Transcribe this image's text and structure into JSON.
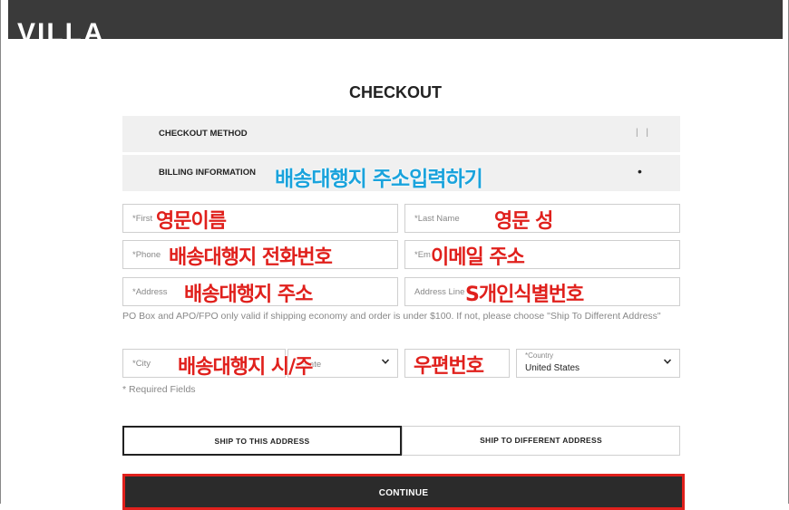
{
  "header": {
    "logo": "VILLA"
  },
  "page_title": "CHECKOUT",
  "steps": [
    {
      "label": "CHECKOUT METHOD",
      "marker": "| |"
    },
    {
      "label": "BILLING INFORMATION",
      "marker": "•",
      "overlay": "배송대행지 주소입력하기"
    }
  ],
  "form": {
    "first_name": {
      "placeholder": "*First",
      "overlay": "영문이름"
    },
    "last_name": {
      "placeholder": "*Last Name",
      "overlay": "영문 성"
    },
    "phone": {
      "placeholder": "*Phone",
      "overlay": "배송대행지 전화번호"
    },
    "email": {
      "placeholder": "*Em",
      "overlay": "이메일 주소"
    },
    "address": {
      "placeholder": "*Address",
      "overlay": "배송대행지 주소"
    },
    "address_line2": {
      "placeholder": "Address Line",
      "overlay": "S개인식별번호"
    },
    "po_note": "PO Box and APO/FPO only valid if shipping economy and order is under $100. If not, please choose \"Ship To Different Address\"",
    "city": {
      "placeholder": "*City",
      "overlay": "배송대행지 시/주"
    },
    "state": {
      "placeholder": "State"
    },
    "zip": {
      "overlay": "우편번호"
    },
    "country": {
      "label": "*Country",
      "value": "United States"
    },
    "required_note": "* Required Fields"
  },
  "shipping": {
    "ship_this": "SHIP TO THIS ADDRESS",
    "ship_different": "SHIP TO DIFFERENT ADDRESS"
  },
  "continue_label": "CONTINUE",
  "colors": {
    "annotation_red": "#e0201c",
    "annotation_cyan": "#1aa3dc",
    "header_bg": "#3a3a3a"
  }
}
